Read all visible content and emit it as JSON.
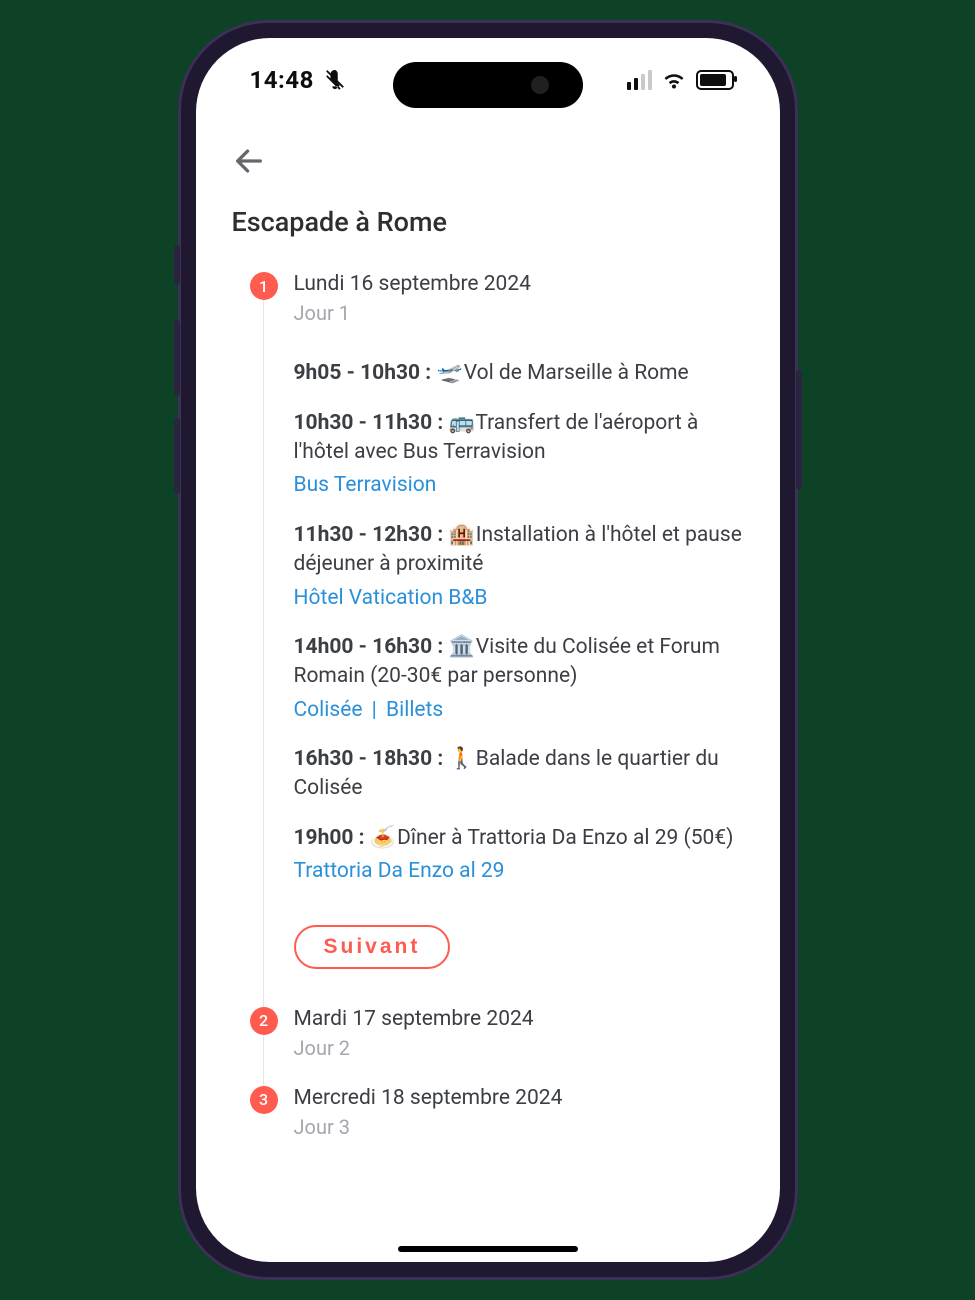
{
  "status": {
    "time": "14:48",
    "mute": true
  },
  "page_title": "Escapade à Rome",
  "next_button_label": "Suivant",
  "link_separator": "|",
  "days": [
    {
      "number": "1",
      "date": "Lundi 16 septembre 2024",
      "subtitle": "Jour 1",
      "expanded": true,
      "events": [
        {
          "time": "9h05 - 10h30 :",
          "emoji": "🛫",
          "text": "Vol de Marseille à Rome",
          "links": []
        },
        {
          "time": "10h30 - 11h30 :",
          "emoji": "🚌",
          "text": "Transfert de l'aéroport à l'hôtel avec Bus Terravision",
          "links": [
            "Bus Terravision"
          ]
        },
        {
          "time": "11h30 - 12h30 :",
          "emoji": "🏨",
          "text": "Installation à l'hôtel et pause déjeuner à proximité",
          "links": [
            "Hôtel Vatication B&B"
          ]
        },
        {
          "time": "14h00 - 16h30 :",
          "emoji": "🏛️",
          "text": "Visite du Colisée et Forum Romain (20-30€ par personne)",
          "links": [
            "Colisée",
            "Billets"
          ]
        },
        {
          "time": "16h30 - 18h30 :",
          "emoji": "🚶",
          "text": "Balade dans le quartier du Colisée",
          "links": []
        },
        {
          "time": "19h00 :",
          "emoji": "🍝",
          "text": "Dîner à Trattoria Da Enzo al 29 (50€)",
          "links": [
            "Trattoria Da Enzo al 29"
          ]
        }
      ]
    },
    {
      "number": "2",
      "date": "Mardi 17 septembre 2024",
      "subtitle": "Jour 2",
      "expanded": false,
      "events": []
    },
    {
      "number": "3",
      "date": "Mercredi 18 septembre 2024",
      "subtitle": "Jour 3",
      "expanded": false,
      "events": []
    }
  ]
}
